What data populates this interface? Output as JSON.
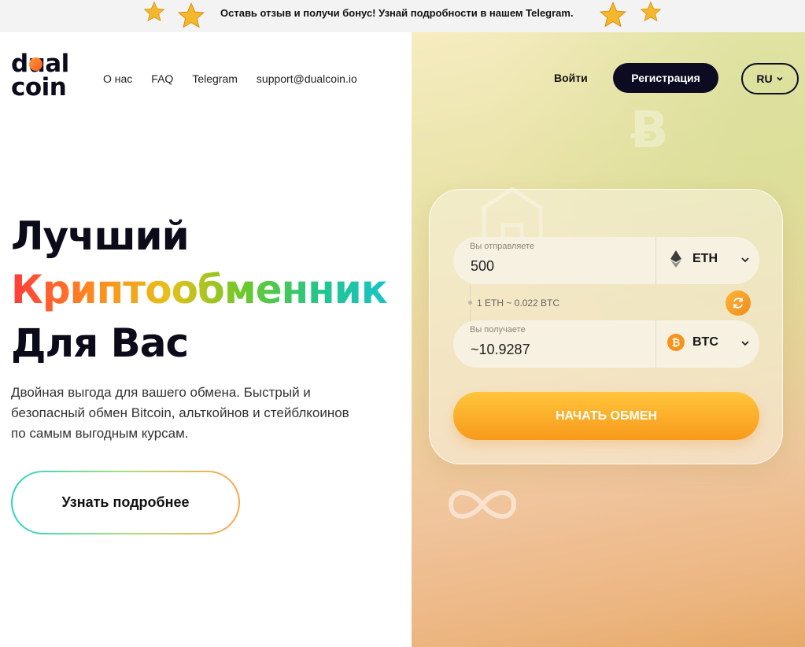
{
  "topbar": {
    "text": "Оставь отзыв и получи бонус! Узнай подробности в нашем Telegram.",
    "icons": [
      "star-icon",
      "star-icon",
      "star-icon",
      "star-icon"
    ]
  },
  "logo": {
    "line1": "dual",
    "line2": "coin"
  },
  "nav": {
    "items": [
      "О нас",
      "FAQ",
      "Telegram",
      "support@dualcoin.io"
    ]
  },
  "header": {
    "login_label": "Войти",
    "register_label": "Регистрация",
    "lang_label": "RU"
  },
  "hero": {
    "title_line1": "Лучший",
    "title_line2": "Криптообменник",
    "title_line3": "Для Вас",
    "subtitle": "Двойная выгода для вашего обмена. Быстрый и безопасный обмен Bitcoin, альткойнов и стейблкоинов по самым выгодным курсам.",
    "more_label": "Узнать подробнее"
  },
  "exchange": {
    "send": {
      "label": "Вы отправляете",
      "value": "500",
      "coin": "ETH",
      "icon": "ethereum-icon"
    },
    "rate": "1 ETH ~ 0.022 BTC",
    "receive": {
      "label": "Вы получаете",
      "value": "~10.9287",
      "coin": "BTC",
      "icon": "bitcoin-icon"
    },
    "start_label": "НАЧАТЬ ОБМЕН"
  },
  "colors": {
    "accent_orange": "#f89a1c",
    "dark": "#0c0b22",
    "panel_gradient_start": "#f6ecc0",
    "panel_gradient_end": "#e6aa68"
  }
}
